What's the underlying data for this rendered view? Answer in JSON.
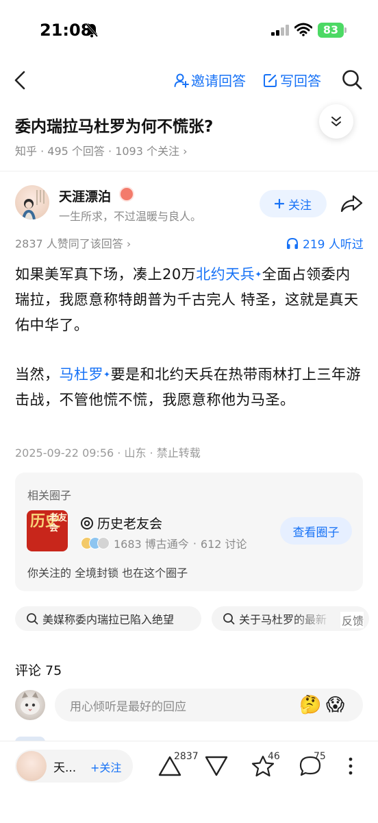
{
  "status_bar": {
    "time": "21:08",
    "battery": "83"
  },
  "nav": {
    "invite_label": "邀请回答",
    "write_label": "写回答"
  },
  "question": {
    "title": "委内瑞拉马杜罗为何不慌张?",
    "source": "知乎",
    "answers": "495 个回答",
    "followers": "1093 个关注"
  },
  "author": {
    "name": "天涯漂泊",
    "bio": "一生所求，不过温暖与良人。",
    "follow_label": "关注",
    "agree_text": "2837 人赞同了该回答",
    "listen_text": "219 人听过"
  },
  "answer": {
    "p1_a": "如果美军真下场，凑上20万",
    "p1_link": "北约天兵",
    "p1_b": "全面占领委内瑞拉，我愿意称特朗普为千古完人 特圣，这就是真天佑中华了。",
    "p2_a": "当然，",
    "p2_link": "马杜罗",
    "p2_b": "要是和北约天兵在热带雨林打上三年游击战，不管他慌不慌，我愿意称他为马圣。",
    "meta": "2025-09-22 09:56 · 山东 · 禁止转载"
  },
  "circle": {
    "section_label": "相关圈子",
    "logo_big": "历史",
    "logo_small": "老友会",
    "name": "历史老友会",
    "members": "1683 博古通今",
    "discussions": "612 讨论",
    "view_label": "查看圈子",
    "footer": "你关注的 全境封锁 也在这个圈子"
  },
  "related_searches": [
    "美媒称委内瑞拉已陷入绝望",
    "关于马杜罗的最新"
  ],
  "feedback_label": "反馈",
  "comments": {
    "title": "评论 75",
    "placeholder": "用心倾听是最好的回应"
  },
  "bottom_bar": {
    "author_short": "天...",
    "follow_label": "+关注",
    "upvotes": "2837",
    "favorites": "46",
    "comments": "75"
  },
  "colors": {
    "accent": "#1772f6",
    "muted": "#8a8a8a"
  }
}
